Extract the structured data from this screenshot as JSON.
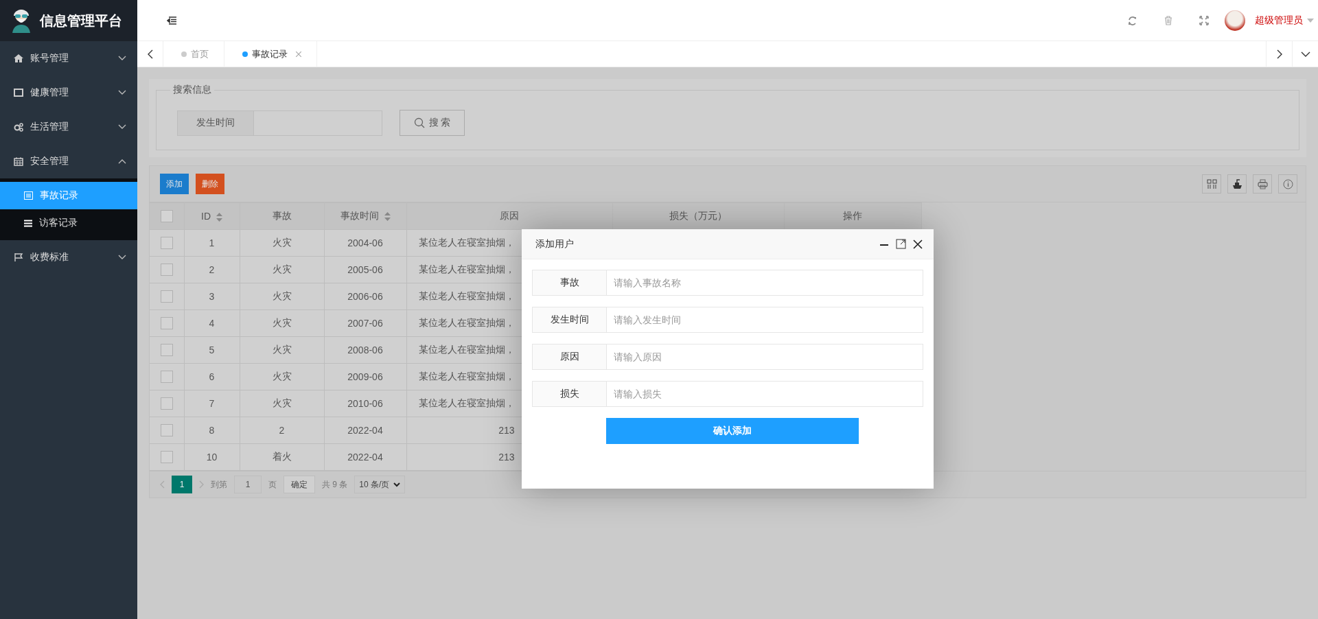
{
  "sidebar": {
    "logo_title": "信息管理平台",
    "items": [
      {
        "label": "账号管理",
        "expanded": false
      },
      {
        "label": "健康管理",
        "expanded": false
      },
      {
        "label": "生活管理",
        "expanded": false
      },
      {
        "label": "安全管理",
        "expanded": true,
        "children": [
          {
            "label": "事故记录",
            "selected": true
          },
          {
            "label": "访客记录",
            "selected": false
          }
        ]
      },
      {
        "label": "收费标准",
        "expanded": false
      }
    ]
  },
  "header": {
    "user_name": "超级管理员"
  },
  "tabs": [
    {
      "label": "首页",
      "selected": false,
      "closable": false
    },
    {
      "label": "事故记录",
      "selected": true,
      "closable": true
    }
  ],
  "search": {
    "legend": "搜索信息",
    "field_label": "发生时间",
    "button": "搜 索"
  },
  "toolbar": {
    "buttons": [
      {
        "label": "添加",
        "kind": "primary"
      },
      {
        "label": "删除",
        "kind": "danger"
      }
    ]
  },
  "table": {
    "all_checked": false,
    "columns": [
      {
        "label": "ID",
        "sortable": true
      },
      {
        "label": "事故",
        "sortable": false
      },
      {
        "label": "事故时间",
        "sortable": true
      },
      {
        "label": "原因",
        "sortable": false
      },
      {
        "label": "损失（万元）",
        "sortable": false
      },
      {
        "label": "操作",
        "sortable": false
      }
    ],
    "rows": [
      {
        "checked": false,
        "cells": [
          "1",
          "火灾",
          "2004-06",
          "某位老人在寝室抽烟，"
        ]
      },
      {
        "checked": false,
        "cells": [
          "2",
          "火灾",
          "2005-06",
          "某位老人在寝室抽烟，"
        ]
      },
      {
        "checked": false,
        "cells": [
          "3",
          "火灾",
          "2006-06",
          "某位老人在寝室抽烟，"
        ]
      },
      {
        "checked": false,
        "cells": [
          "4",
          "火灾",
          "2007-06",
          "某位老人在寝室抽烟，"
        ]
      },
      {
        "checked": false,
        "cells": [
          "5",
          "火灾",
          "2008-06",
          "某位老人在寝室抽烟，"
        ]
      },
      {
        "checked": false,
        "cells": [
          "6",
          "火灾",
          "2009-06",
          "某位老人在寝室抽烟，"
        ]
      },
      {
        "checked": false,
        "cells": [
          "7",
          "火灾",
          "2010-06",
          "某位老人在寝室抽烟，"
        ]
      },
      {
        "checked": false,
        "cells": [
          "8",
          "2",
          "2022-04",
          "213"
        ]
      },
      {
        "checked": false,
        "cells": [
          "10",
          "着火",
          "2022-04",
          "213"
        ]
      }
    ]
  },
  "pagination": {
    "current_page": "1",
    "goto_label": "到第",
    "page_input": "1",
    "page_unit": "页",
    "confirm": "确定",
    "total": "共 9 条",
    "page_size": "10 条/页"
  },
  "modal": {
    "title": "添加用户",
    "fields": [
      {
        "label": "事故",
        "placeholder": "请输入事故名称"
      },
      {
        "label": "发生时间",
        "placeholder": "请输入发生时间"
      },
      {
        "label": "原因",
        "placeholder": "请输入原因"
      },
      {
        "label": "损失",
        "placeholder": "请输入损失"
      }
    ],
    "submit": "确认添加"
  }
}
